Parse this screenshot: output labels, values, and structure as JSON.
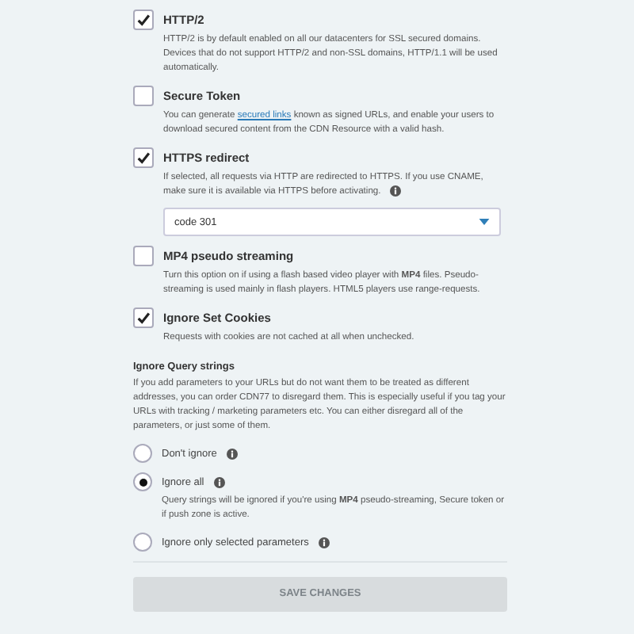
{
  "options": [
    {
      "label": "HTTP/2",
      "checked": true,
      "description": [
        {
          "kind": "text",
          "text": "HTTP/2 is by default enabled on all our datacenters for SSL secured domains. Devices that do not support HTTP/2 and non-SSL domains, HTTP/1.1 will be used automatically."
        }
      ]
    },
    {
      "label": "Secure Token",
      "checked": false,
      "description": [
        {
          "kind": "text",
          "text": "You can generate "
        },
        {
          "kind": "link",
          "text": "secured links"
        },
        {
          "kind": "text",
          "text": " known as signed URLs, and enable your users to download secured content from the CDN Resource with a valid hash."
        }
      ]
    },
    {
      "label": "HTTPS redirect",
      "checked": true,
      "description": [
        {
          "kind": "text",
          "text": "If selected, all requests via HTTP are redirected to HTTPS. If you use CNAME, make sure it is available via HTTPS before activating."
        }
      ],
      "info": true,
      "select": {
        "value": "code 301"
      }
    },
    {
      "label": "MP4 pseudo streaming",
      "checked": false,
      "description": [
        {
          "kind": "text",
          "text": "Turn this option on if using a flash based video player with **MP4** files. Pseudo-streaming is used mainly in flash players. HTML5 players use range-requests."
        }
      ]
    },
    {
      "label": "Ignore Set Cookies",
      "checked": true,
      "description": [
        {
          "kind": "text",
          "text": "Requests with cookies are not cached at all when unchecked."
        }
      ]
    }
  ],
  "query_strings": {
    "title": "Ignore Query strings",
    "description": "If you add parameters to your URLs but do not want them to be treated as different addresses, you can order CDN77 to disregard them. This is especially useful if you tag your URLs with tracking / marketing parameters etc. You can either disregard all of the parameters, or just some of them.",
    "choices": [
      {
        "label": "Don't ignore",
        "selected": false
      },
      {
        "label": "Ignore all",
        "selected": true,
        "description": "Query strings will be ignored if you're using **MP4** pseudo-streaming, Secure token or if push zone is active."
      },
      {
        "label": "Ignore only selected parameters",
        "selected": false
      }
    ]
  },
  "save_button": {
    "label": "SAVE CHANGES",
    "disabled": true
  }
}
